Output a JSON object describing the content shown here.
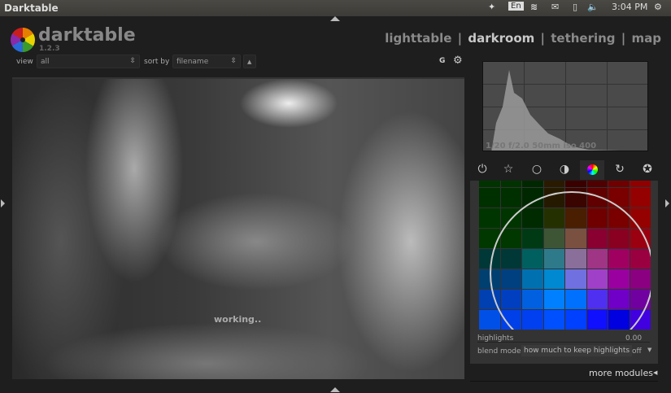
{
  "window": {
    "title": "Darktable"
  },
  "tray": {
    "lang": "En",
    "time": "3:04 PM"
  },
  "app": {
    "name": "darktable",
    "version": "1.2.3"
  },
  "views": {
    "lighttable": "lighttable",
    "darkroom": "darkroom",
    "tethering": "tethering",
    "map": "map",
    "sep": "|"
  },
  "filter": {
    "view_label": "view",
    "view_value": "all",
    "sort_label": "sort by",
    "sort_value": "filename",
    "order": "▲",
    "grouping": "G"
  },
  "center": {
    "status": "working.."
  },
  "histogram": {
    "exif": "1/20 f/2.0 50mm iso 400"
  },
  "module_groups": [
    {
      "name": "power",
      "glyph": "⏻"
    },
    {
      "name": "favorites",
      "glyph": "☆"
    },
    {
      "name": "basic",
      "glyph": "○"
    },
    {
      "name": "tone",
      "glyph": "◑"
    },
    {
      "name": "color",
      "glyph": "●"
    },
    {
      "name": "correct",
      "glyph": "↻"
    },
    {
      "name": "effect",
      "glyph": "✪"
    }
  ],
  "active_group": 4,
  "colorchecker": [
    [
      "#003300",
      "#003300",
      "#002800",
      "#2a1a00",
      "#3a0000",
      "#500000",
      "#700000",
      "#900000"
    ],
    [
      "#003000",
      "#003000",
      "#002800",
      "#251a00",
      "#3a0500",
      "#600000",
      "#7a0000",
      "#950000"
    ],
    [
      "#003500",
      "#003500",
      "#002a00",
      "#253000",
      "#4a1e00",
      "#700000",
      "#7a0000",
      "#950000"
    ],
    [
      "#003800",
      "#003800",
      "#003a15",
      "#3d5535",
      "#7a5040",
      "#8a0030",
      "#8a0020",
      "#9a0010"
    ],
    [
      "#003838",
      "#003838",
      "#006060",
      "#2f7a8a",
      "#8a6f9a",
      "#a03585",
      "#a00060",
      "#9a0040"
    ],
    [
      "#004070",
      "#004080",
      "#0070b0",
      "#0088d0",
      "#7070e0",
      "#a040c8",
      "#9a00a0",
      "#8a0080"
    ],
    [
      "#0040b0",
      "#0040c0",
      "#0060e0",
      "#0080ff",
      "#0070ff",
      "#5030f0",
      "#7000c8",
      "#7000a0"
    ],
    [
      "#0050e8",
      "#0040e8",
      "#0040f0",
      "#0050ff",
      "#0040ff",
      "#1010ff",
      "#0000e0",
      "#4000e0"
    ]
  ],
  "module": {
    "highlights_label": "highlights",
    "highlights_value": "0.00",
    "blend_label": "blend mode",
    "blend_tooltip": "how much to keep highlights",
    "blend_value": "off"
  },
  "more_modules": "more modules"
}
